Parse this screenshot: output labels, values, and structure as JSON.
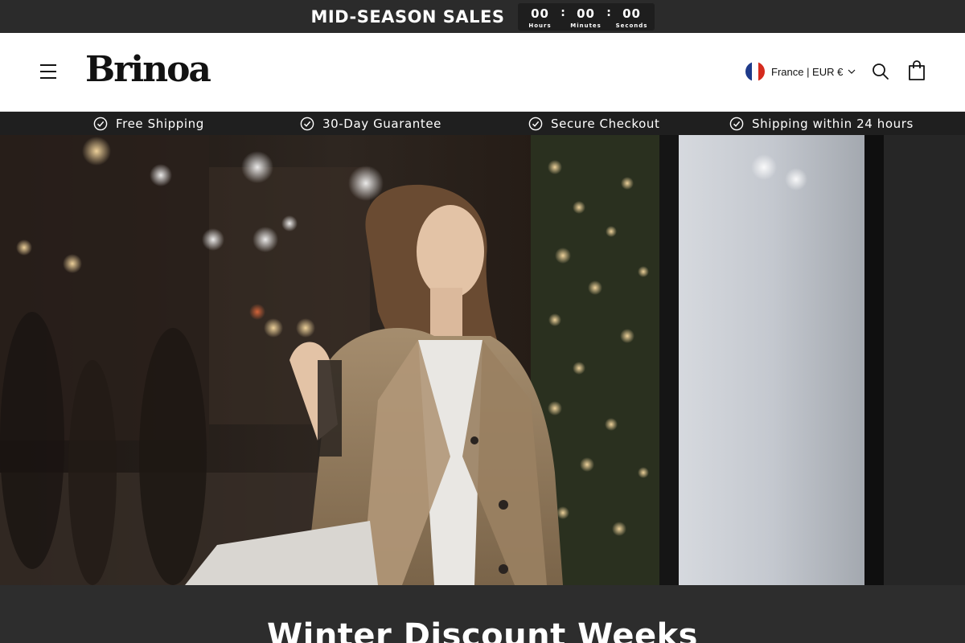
{
  "announcement": {
    "title": "MID-SEASON SALES",
    "countdown": {
      "hours": "00",
      "hours_label": "Hours",
      "minutes": "00",
      "minutes_label": "Minutes",
      "seconds": "00",
      "seconds_label": "Seconds",
      "separator": ":"
    }
  },
  "header": {
    "logo": "Brinoa",
    "locale": "France | EUR €",
    "icons": {
      "menu": "menu-icon",
      "search": "search-icon",
      "cart": "cart-icon",
      "flag": "france-flag-icon"
    }
  },
  "features": [
    {
      "label": "Free Shipping",
      "icon": "check-circle-icon"
    },
    {
      "label": "30-Day Guarantee",
      "icon": "check-circle-icon"
    },
    {
      "label": "Secure Checkout",
      "icon": "check-circle-icon"
    },
    {
      "label": "Shipping within 24 hours",
      "icon": "check-circle-icon"
    }
  ],
  "promo": {
    "title": "Winter Discount Weeks"
  },
  "colors": {
    "announcement_bg": "#2b2b2b",
    "features_bg": "#1f1f1f",
    "promo_bg": "#2d2d2d",
    "text_dark": "#121212",
    "flag_blue": "#1e3a8a",
    "flag_white": "#ffffff",
    "flag_red": "#d52b1e"
  }
}
